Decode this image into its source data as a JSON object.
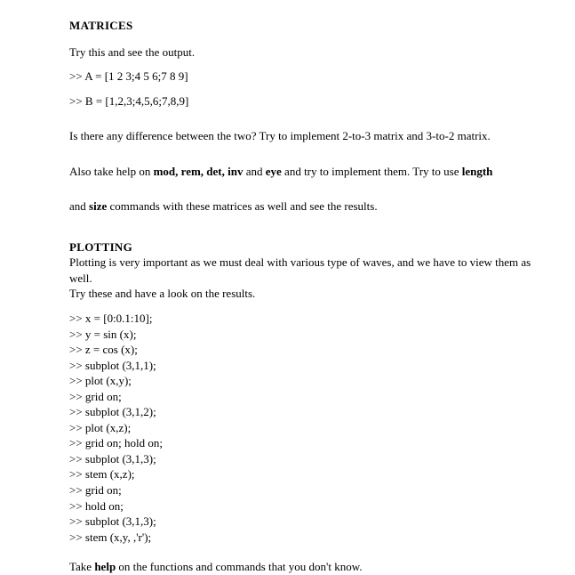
{
  "matrices": {
    "heading": "MATRICES",
    "try_line": "Try this and see the output.",
    "code_a": ">> A = [1 2 3;4 5 6;7 8 9]",
    "code_b": ">> B = [1,2,3;4,5,6;7,8,9]",
    "diff_line": "Is there any difference between the two? Try to implement 2-to-3 matrix and 3-to-2 matrix.",
    "help_prefix": "Also take help on ",
    "help_bold": "mod, rem, det, inv",
    "help_and": " and ",
    "help_bold2": "eye",
    "help_suffix": " and try to implement them. Try to use ",
    "help_bold3": "length",
    "size_prefix": "and ",
    "size_bold": "size",
    "size_suffix": " commands with these matrices as well and see the results."
  },
  "plotting": {
    "heading": "PLOTTING",
    "desc": "Plotting is very important as we must deal with various type of waves, and we have to view them as well.",
    "try_line": "Try these and have a look on the results.",
    "code_lines": [
      ">> x = [0:0.1:10];",
      ">> y = sin (x);",
      ">> z = cos (x);",
      ">> subplot (3,1,1);",
      ">> plot (x,y);",
      ">> grid on;",
      ">> subplot (3,1,2);",
      ">> plot (x,z);",
      ">> grid on; hold on;",
      ">> subplot (3,1,3);",
      ">> stem (x,z);",
      ">> grid on;",
      ">> hold on;",
      ">> subplot (3,1,3);",
      ">> stem (x,y, ,'r');"
    ],
    "footer_prefix": "Take ",
    "footer_bold": "help",
    "footer_suffix": " on the functions and commands that you don't know."
  }
}
